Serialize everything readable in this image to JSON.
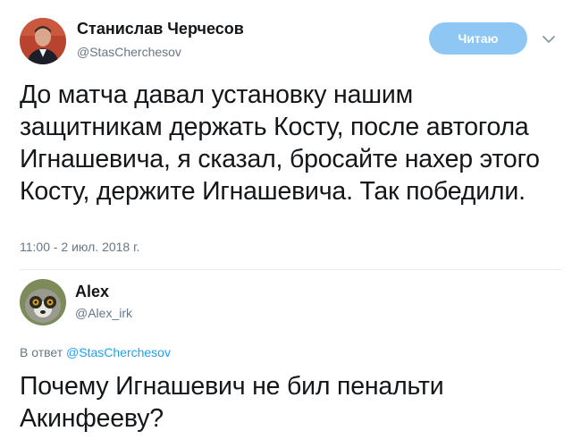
{
  "tweet": {
    "author_name": "Станислав Черчесов",
    "author_handle": "@StasCherchesov",
    "follow_label": "Читаю",
    "text": "До матча давал установку нашим защитникам держать Косту, после автогола Игнашевича, я сказал, бросайте нахер этого Косту, держите Игнашевича. Так победили.",
    "meta": "11:00 - 2 июл. 2018 г."
  },
  "reply": {
    "author_name": "Alex",
    "author_handle": "@Alex_irk",
    "reply_prefix": "В ответ",
    "reply_to": "@StasCherchesov",
    "text": "Почему Игнашевич не бил пенальти Акинфееву?"
  },
  "icons": {
    "menu": "chevron-down-icon"
  },
  "colors": {
    "follow_button": "#8ec7f3",
    "link": "#1da1f2",
    "secondary_text": "#657786",
    "primary_text": "#14171a"
  }
}
